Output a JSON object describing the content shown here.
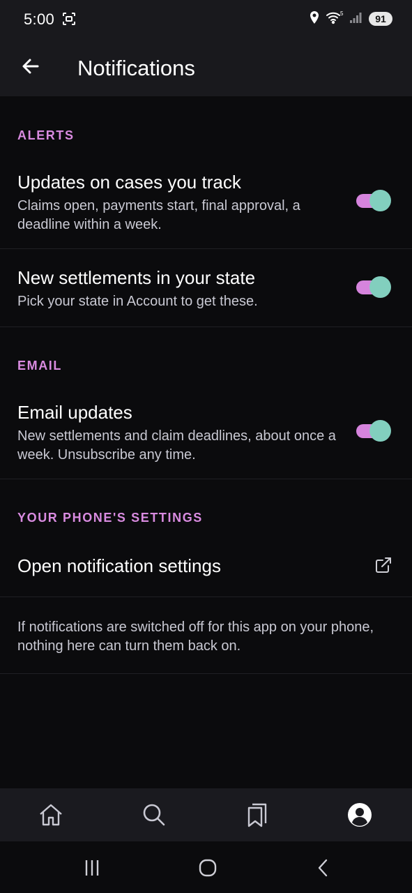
{
  "status_bar": {
    "time": "5:00",
    "battery": "91",
    "icons": [
      "screenshot-icon",
      "location-icon",
      "wifi-icon",
      "signal-icon",
      "battery-icon"
    ]
  },
  "app_bar": {
    "title": "Notifications",
    "back_icon": "arrow-left-icon"
  },
  "sections": {
    "alerts": {
      "header": "ALERTS",
      "items": [
        {
          "title": "Updates on cases you track",
          "subtitle": "Claims open, payments start, final approval, a deadline within a week.",
          "enabled": true
        },
        {
          "title": "New settlements in your state",
          "subtitle": "Pick your state in Account to get these.",
          "enabled": true
        }
      ]
    },
    "email": {
      "header": "EMAIL",
      "items": [
        {
          "title": "Email updates",
          "subtitle": "New settlements and claim deadlines, about once a week. Unsubscribe any time.",
          "enabled": true
        }
      ]
    },
    "phone": {
      "header": "YOUR PHONE'S SETTINGS",
      "link_label": "Open notification settings",
      "link_icon": "external-link-icon",
      "note": "If notifications are switched off for this app on your phone, nothing here can turn them back on."
    }
  },
  "bottom_nav": {
    "items": [
      "home-icon",
      "search-icon",
      "bookmarks-icon",
      "profile-icon"
    ],
    "active": "profile-icon"
  },
  "system_nav": [
    "recent-apps-icon",
    "home-button-icon",
    "back-icon"
  ],
  "colors": {
    "accent": "#d98be0",
    "toggle_track": "#d684dd",
    "toggle_thumb": "#82cfbe",
    "background": "#0b0b0d",
    "surface": "#19191d"
  }
}
